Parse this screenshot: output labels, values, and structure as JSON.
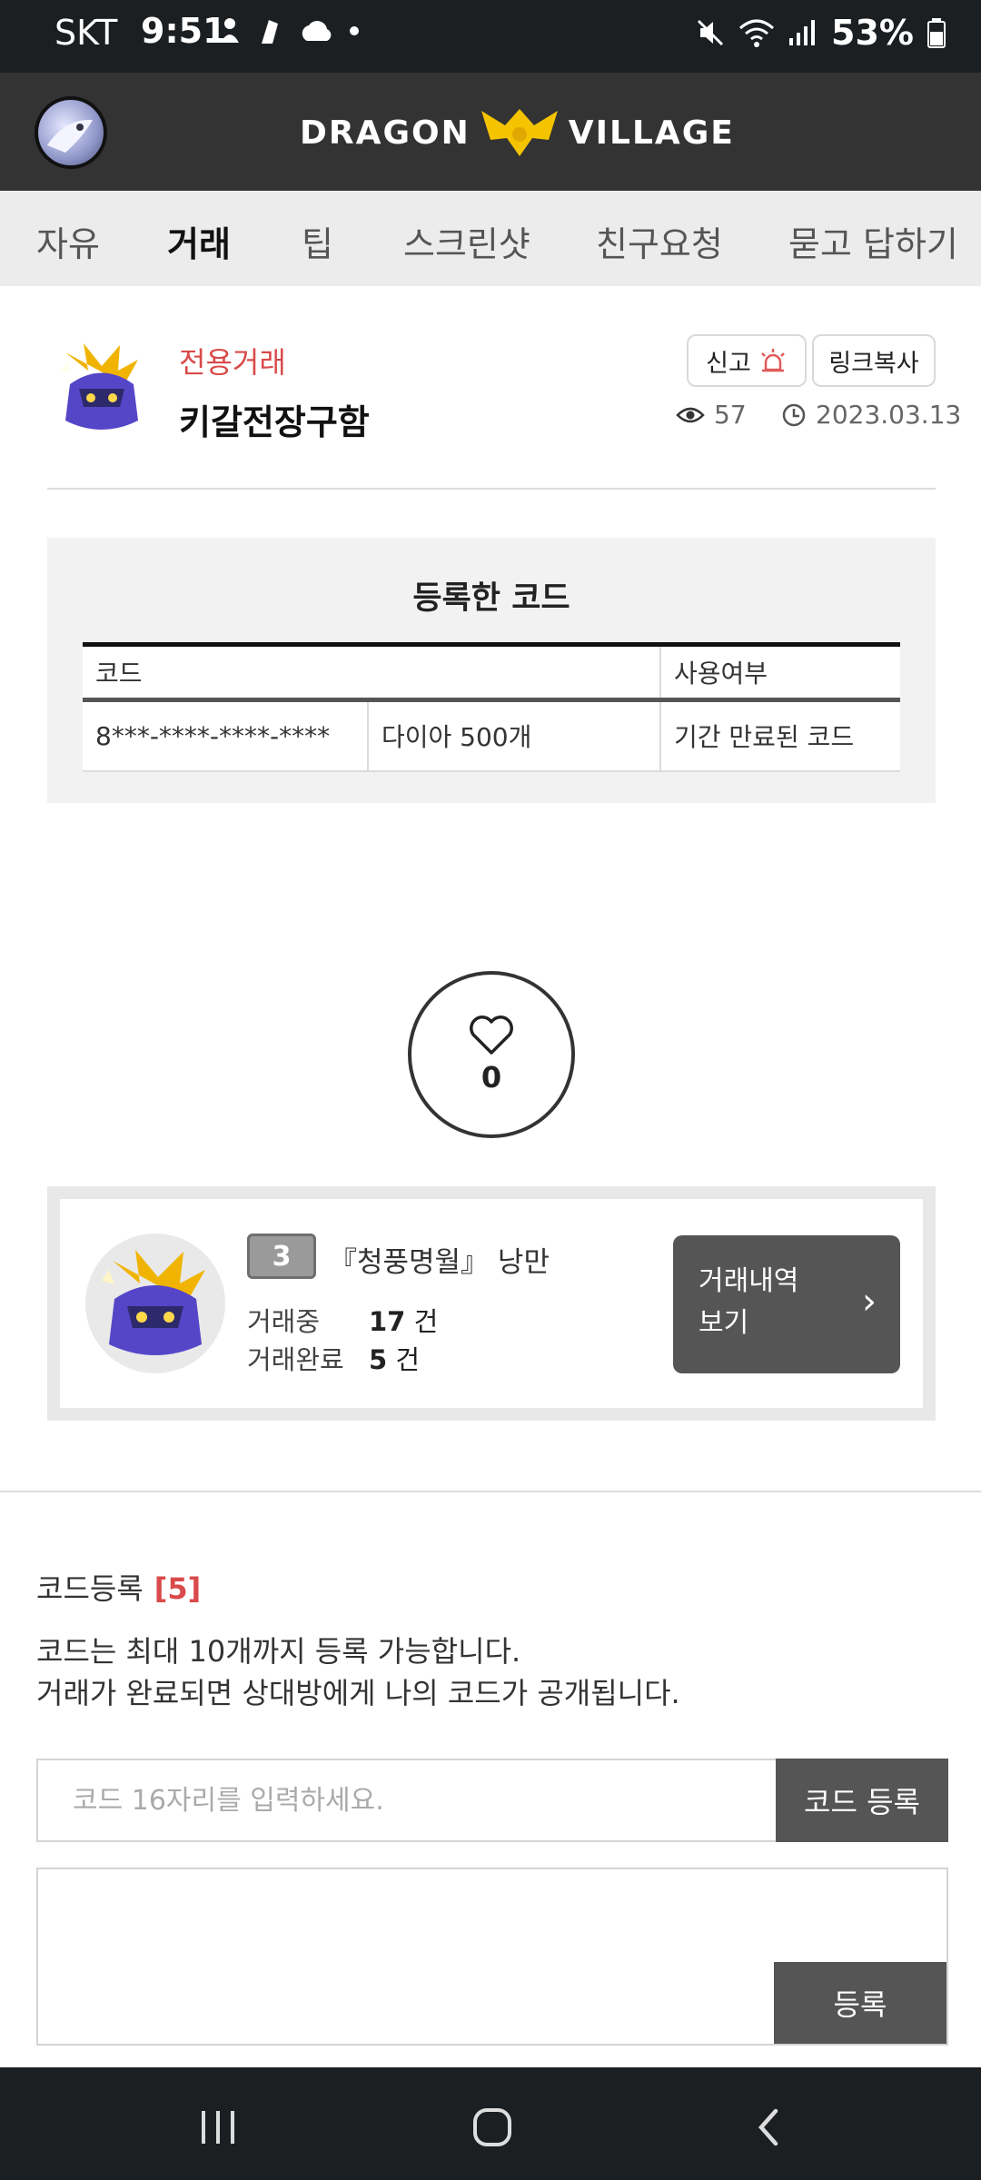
{
  "status_bar": {
    "carrier": "SKT",
    "time": "9:51",
    "battery": "53%"
  },
  "header": {
    "logo_left": "DRAGON",
    "logo_right": "VILLAGE"
  },
  "tabs": [
    {
      "label": "자유"
    },
    {
      "label": "거래"
    },
    {
      "label": "팁"
    },
    {
      "label": "스크린샷"
    },
    {
      "label": "친구요청"
    },
    {
      "label": "묻고 답하기"
    }
  ],
  "active_tab": "거래",
  "post": {
    "category": "전용거래",
    "title": "키갈전장구함",
    "report_label": "신고",
    "copy_link_label": "링크복사",
    "views": "57",
    "date": "2023.03.13"
  },
  "codes": {
    "title": "등록한 코드",
    "headers": [
      "코드",
      "사용여부"
    ],
    "rows": [
      {
        "code": "8***-****-****-****",
        "item": "다이아 500개",
        "status": "기간 만료된 코드"
      }
    ]
  },
  "like": {
    "count": "0"
  },
  "trader": {
    "rank": "3",
    "name": "『청풍명월』 낭만",
    "trading_label": "거래중",
    "trading_count": "17",
    "completed_label": "거래완료",
    "completed_count": "5",
    "unit": "건",
    "history_line1": "거래내역",
    "history_line2": "보기"
  },
  "register": {
    "title": "코드등록",
    "count": "[5]",
    "desc_line1": "코드는 최대 10개까지 등록 가능합니다.",
    "desc_line2": "거래가 완료되면 상대방에게 나의 코드가 공개됩니다.",
    "input_placeholder": "코드 16자리를 입력하세요.",
    "submit_label": "코드 등록",
    "comment_submit_label": "등록"
  },
  "colors": {
    "accent_red": "#d94a4a",
    "tab_underline": "#f5b900",
    "header_bg": "#333333",
    "button_bg": "#555555"
  }
}
